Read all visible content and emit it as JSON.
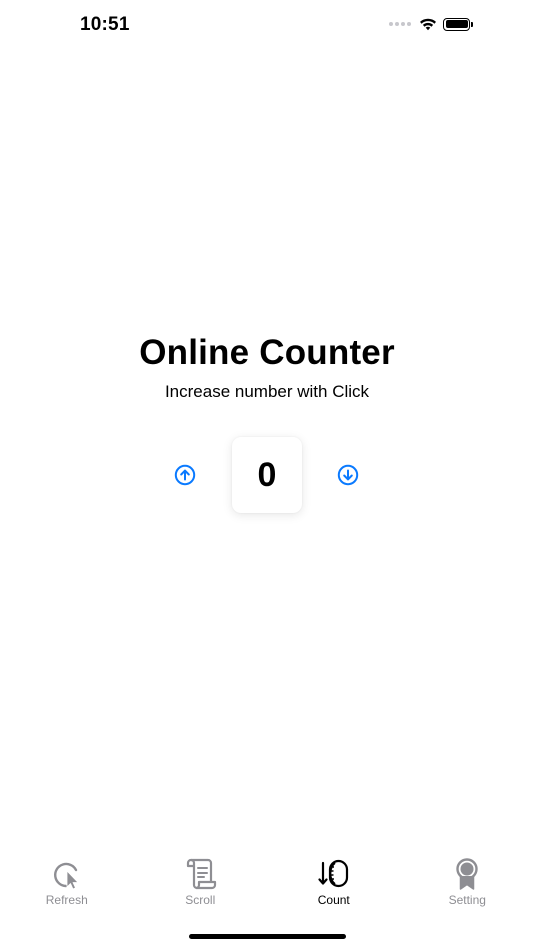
{
  "status_bar": {
    "time": "10:51",
    "icons": [
      "signal-icon",
      "wifi-icon",
      "battery-icon"
    ]
  },
  "main": {
    "title": "Online Counter",
    "subtitle": "Increase number with Click",
    "counter_value": "0",
    "accent_color": "#0a7aff",
    "buttons": [
      "arrow-up-circle-icon",
      "arrow-down-circle-icon"
    ]
  },
  "tabs": [
    {
      "label": "Refresh",
      "icon": "refresh-cursor-icon",
      "active": false
    },
    {
      "label": "Scroll",
      "icon": "scroll-icon",
      "active": false
    },
    {
      "label": "Count",
      "icon": "count-wheel-icon",
      "active": true
    },
    {
      "label": "Setting",
      "icon": "award-ribbon-icon",
      "active": false
    }
  ],
  "colors": {
    "inactive_tab": "#8e8e93",
    "active_tab": "#000000"
  }
}
